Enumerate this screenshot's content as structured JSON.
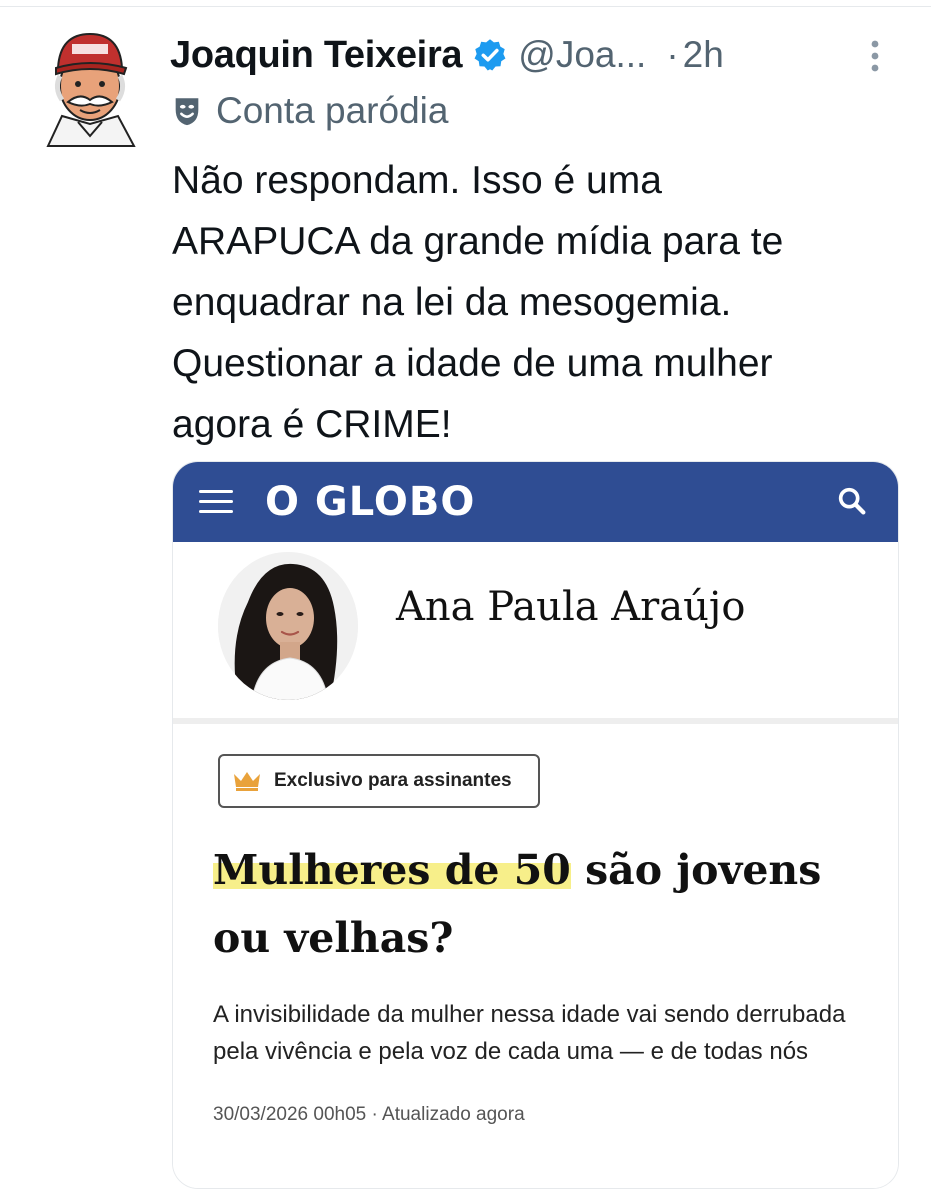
{
  "tweet": {
    "author": {
      "display_name": "Joaquin Teixeira",
      "handle": "@Joa...",
      "verified": true
    },
    "separator": "·",
    "time": "2h",
    "label": "Conta paródia",
    "text": "Não respondam. Isso é uma\nARAPUCA da grande mídia para te\nenquadrar na lei da mesogemia.\nQuestionar a idade de uma mulher\nagora é CRIME!"
  },
  "embed": {
    "site_logo": "O GLOBO",
    "author_name": "Ana Paula Araújo",
    "badge": "Exclusivo para assinantes",
    "headline_highlight": "Mulheres de 50",
    "headline_rest": " são jovens ou velhas?",
    "summary": "A invisibilidade da mulher nessa idade vai sendo derrubada pela vivência e pela voz de cada uma — e de todas nós",
    "date": "30/03/2026 00h05 · Atualizado agora"
  },
  "colors": {
    "accent_verified": "#1d9bf0",
    "globo_blue": "#2f4d93",
    "highlight": "#f7ef8a"
  },
  "icons": [
    "verified-badge-icon",
    "more-options-icon",
    "parody-mask-icon",
    "hamburger-menu-icon",
    "search-icon",
    "crown-icon"
  ]
}
